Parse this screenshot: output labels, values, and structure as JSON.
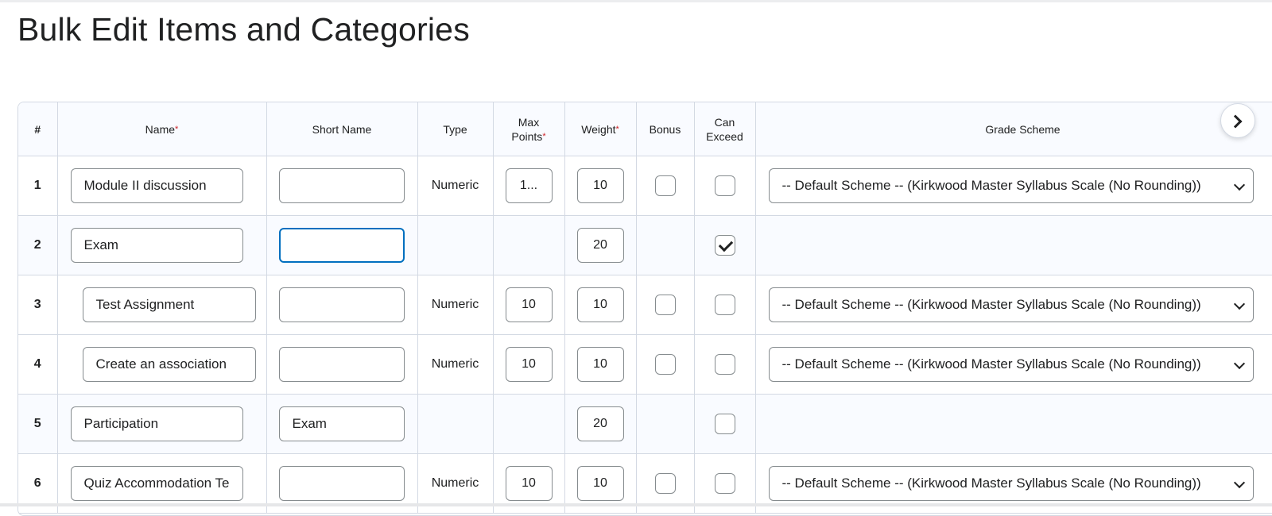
{
  "page": {
    "title": "Bulk Edit Items and Categories"
  },
  "table": {
    "headers": {
      "num": "#",
      "name": "Name",
      "short_name": "Short Name",
      "type": "Type",
      "max_points_line1": "Max",
      "max_points_line2": "Points",
      "weight": "Weight",
      "bonus": "Bonus",
      "can_exceed_line1": "Can",
      "can_exceed_line2": "Exceed",
      "grade_scheme": "Grade Scheme",
      "required_mark": "*"
    },
    "rows": [
      {
        "num": "1",
        "name": "Module II discussion",
        "short_name": "",
        "type": "Numeric",
        "max_points": "1...",
        "weight": "10",
        "bonus": false,
        "can_exceed": false,
        "grade_scheme": "-- Default Scheme -- (Kirkwood Master Syllabus Scale (No Rounding))"
      },
      {
        "num": "2",
        "name": "Exam",
        "short_name": "",
        "type": "",
        "max_points": "",
        "weight": "20",
        "can_exceed": true
      },
      {
        "num": "3",
        "name": "Test Assignment",
        "short_name": "",
        "type": "Numeric",
        "max_points": "10",
        "weight": "10",
        "bonus": false,
        "can_exceed": false,
        "grade_scheme": "-- Default Scheme -- (Kirkwood Master Syllabus Scale (No Rounding))"
      },
      {
        "num": "4",
        "name": "Create an association",
        "short_name": "",
        "type": "Numeric",
        "max_points": "10",
        "weight": "10",
        "bonus": false,
        "can_exceed": false,
        "grade_scheme": "-- Default Scheme -- (Kirkwood Master Syllabus Scale (No Rounding))"
      },
      {
        "num": "5",
        "name": "Participation",
        "short_name": "Exam",
        "type": "",
        "max_points": "",
        "weight": "20",
        "can_exceed": false
      },
      {
        "num": "6",
        "name": "Quiz Accommodation Te",
        "short_name": "",
        "type": "Numeric",
        "max_points": "10",
        "weight": "10",
        "bonus": false,
        "can_exceed": false,
        "grade_scheme": "-- Default Scheme -- (Kirkwood Master Syllabus Scale (No Rounding))"
      }
    ]
  },
  "icons": {
    "scroll_right": "chevron-right-icon",
    "dropdown": "chevron-down-icon"
  },
  "colors": {
    "focus": "#006fbf",
    "required": "#cd2026",
    "header_bg": "#f9fbff",
    "border": "#d3d9e3"
  }
}
